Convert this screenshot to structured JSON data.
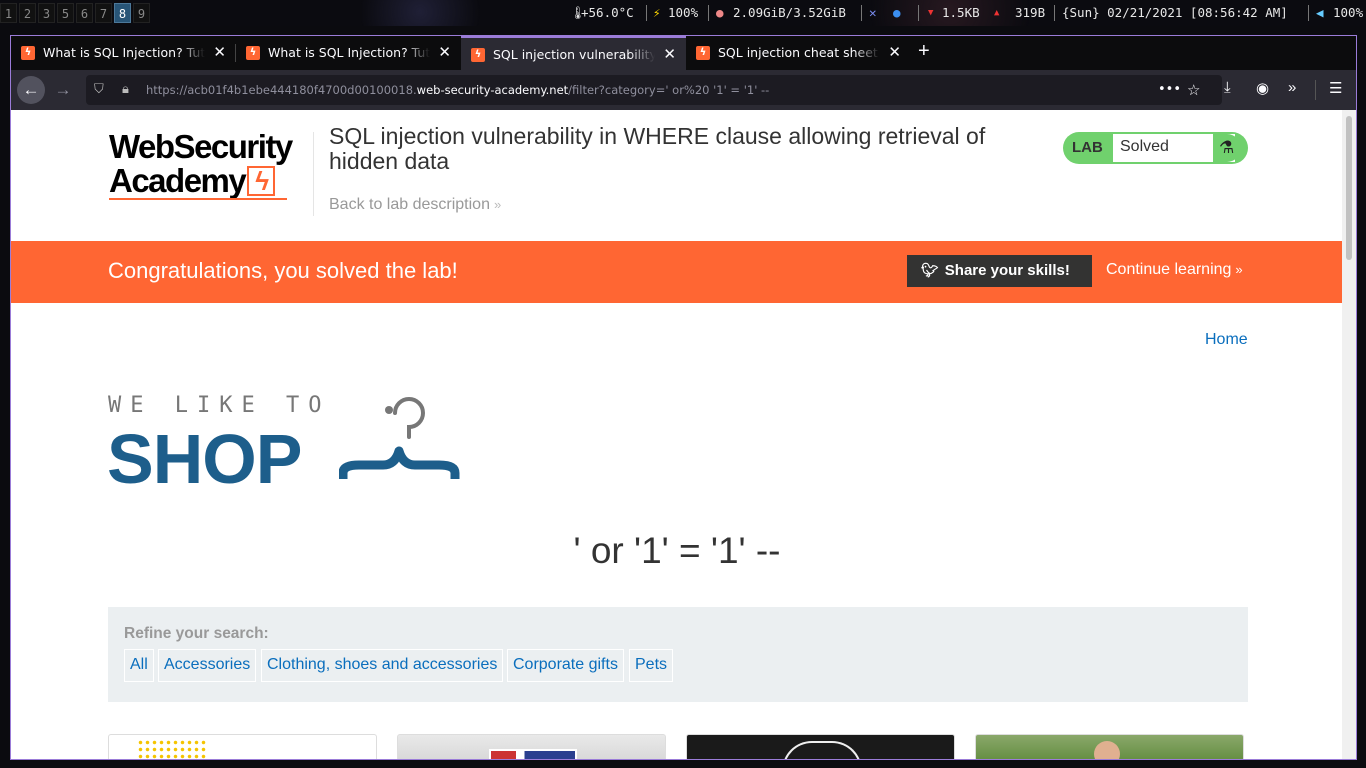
{
  "system_bar": {
    "workspaces": [
      "1",
      "2",
      "3",
      "5",
      "6",
      "7",
      "8",
      "9"
    ],
    "active_workspace": "8",
    "temperature": "+56.0°C",
    "battery": "100%",
    "memory": "2.09GiB/3.52GiB",
    "net_down": "1.5KB",
    "net_up": "319B",
    "datetime": "{Sun} 02/21/2021 [08:56:42 AM]",
    "volume": "100%"
  },
  "browser": {
    "tabs": [
      {
        "title": "What is SQL Injection? Tutorial & Examples | Web Security Academy"
      },
      {
        "title": "What is SQL Injection? Tutorial & Examples | Web Security Academy"
      },
      {
        "title": "SQL injection vulnerability in WHERE clause allowing retrieval of hidden data"
      },
      {
        "title": "SQL injection cheat sheet | Web Security Academy"
      }
    ],
    "active_tab": 2,
    "url_prefix": "https://acb01f4b1ebe444180f4700d00100018.",
    "url_host": "web-security-academy.net",
    "url_path": "/filter?category=' or%20 '1' = '1' --"
  },
  "academy_header": {
    "logo_line1": "WebSecurity",
    "logo_line2": "Academy",
    "lab_title": "SQL injection vulnerability in WHERE clause allowing retrieval of hidden data",
    "back_link": "Back to lab description",
    "lab_badge": "LAB",
    "lab_status": "Solved"
  },
  "congrats": {
    "message": "Congratulations, you solved the lab!",
    "share_button": "Share your skills!",
    "continue_link": "Continue learning"
  },
  "shop": {
    "home_link": "Home",
    "logo_tagline": "WE LIKE TO",
    "logo_word": "SHOP",
    "search_heading": "' or '1' = '1' --",
    "refine_label": "Refine your search:",
    "categories": [
      "All",
      "Accessories",
      "Clothing, shoes and accessories",
      "Corporate gifts",
      "Pets"
    ]
  },
  "colors": {
    "accent": "#ff6633",
    "lab_green": "#70d16d",
    "link_blue": "#0a6ebd",
    "shop_blue": "#1d5e8b",
    "browser_accent": "#9b7cd8"
  }
}
